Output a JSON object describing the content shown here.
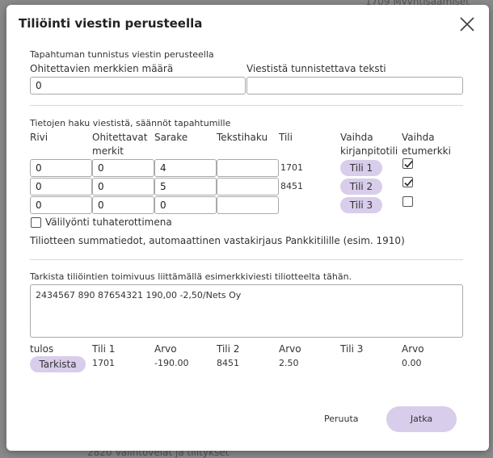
{
  "background": {
    "top_snippet": "1709 Myyntisaamiset",
    "bottom_snippet": "2820 Valintovelat ja tilitykset"
  },
  "dialog": {
    "title": "Tiliöinti viestin perusteella",
    "close_icon": "close-icon"
  },
  "identification": {
    "section_label": "Tapahtuman tunnistus viestin perusteella",
    "skip_count_label": "Ohitettavien merkkien määrä",
    "skip_count_value": "0",
    "text_label": "Viestistä tunnistettava teksti",
    "text_value": ""
  },
  "rules": {
    "section_label": "Tietojen haku viestistä, säännöt tapahtumille",
    "headers": {
      "row": "Rivi",
      "skip_line1": "Ohitettavat",
      "skip_line2": "merkit",
      "column": "Sarake",
      "text_search": "Tekstihaku",
      "account": "Tili",
      "switch_account_line1": "Vaihda",
      "switch_account_line2": "kirjanpitotili",
      "switch_sign_line1": "Vaihda",
      "switch_sign_line2": "etumerkki"
    },
    "rows": [
      {
        "row": "0",
        "skip": "0",
        "column": "4",
        "text": "",
        "account": "1701",
        "button": "Tili 1",
        "sign": true
      },
      {
        "row": "0",
        "skip": "0",
        "column": "5",
        "text": "",
        "account": "8451",
        "button": "Tili 2",
        "sign": true
      },
      {
        "row": "0",
        "skip": "0",
        "column": "0",
        "text": "",
        "account": "",
        "button": "Tili 3",
        "sign": false
      }
    ],
    "thousands_label": "Välilyönti tuhaterottimena",
    "thousands_checked": false,
    "summary_text": "Tiliotteen summatiedot, automaattinen vastakirjaus Pankkitilille (esim. 1910)"
  },
  "check": {
    "section_label": "Tarkista tiliöintien toimivuus liittämällä esimerkkiviesti tiliotteelta tähän.",
    "sample_text": "2434567 890 87654321 190,00 -2,50/Nets Oy",
    "result_headers": {
      "result": "tulos",
      "acc1": "Tili 1",
      "val1": "Arvo",
      "acc2": "Tili 2",
      "val2": "Arvo",
      "acc3": "Tili 3",
      "val3": "Arvo"
    },
    "check_button": "Tarkista",
    "results": {
      "acc1": "1701",
      "val1": "-190.00",
      "acc2": "8451",
      "val2": "2.50",
      "acc3": "",
      "val3": "0.00"
    }
  },
  "footer": {
    "cancel_label": "Peruuta",
    "continue_label": "Jatka"
  },
  "colors": {
    "accent_pill": "#d8cdea",
    "overlay": "#8a8a8a"
  }
}
